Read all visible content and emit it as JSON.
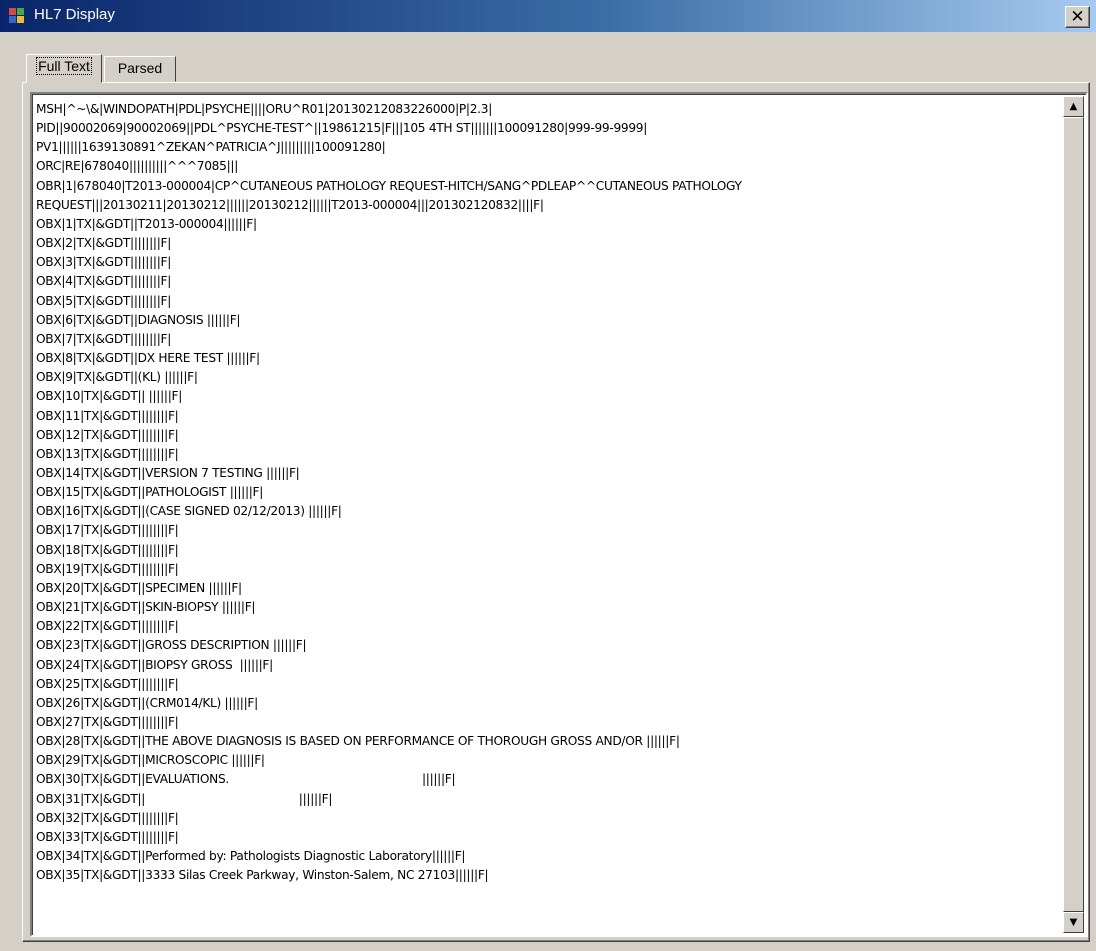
{
  "window": {
    "title": "HL7 Display",
    "close_label": "✕",
    "icon": "app-window-icon",
    "titlebar_colors": [
      "#0a246a",
      "#3a6ea5",
      "#a6caf0"
    ]
  },
  "tabs": [
    {
      "label": "Full Text",
      "active": true
    },
    {
      "label": "Parsed",
      "active": false
    }
  ],
  "scrollbar": {
    "up_icon": "▲",
    "down_icon": "▼"
  },
  "message_lines": [
    "MSH|^~\\&|WINDOPATH|PDL|PSYCHE||||ORU^R01|20130212083226000|P|2.3|",
    "PID||90002069|90002069||PDL^PSYCHE-TEST^||19861215|F|||105 4TH ST|||||||100091280|999-99-9999|",
    "PV1||||||1639130891^ZEKAN^PATRICIA^J|||||||||100091280|",
    "ORC|RE|678040||||||||||^^^7085|||",
    "OBR|1|678040|T2013-000004|CP^CUTANEOUS PATHOLOGY REQUEST-HITCH/SANG^PDLEAP^^CUTANEOUS PATHOLOGY",
    "REQUEST|||20130211|20130212||||||20130212||||||T2013-000004|||201302120832||||F|",
    "OBX|1|TX|&GDT||T2013-000004||||||F|",
    "OBX|2|TX|&GDT||||||||F|",
    "OBX|3|TX|&GDT||||||||F|",
    "OBX|4|TX|&GDT||||||||F|",
    "OBX|5|TX|&GDT||||||||F|",
    "OBX|6|TX|&GDT||DIAGNOSIS ||||||F|",
    "OBX|7|TX|&GDT||||||||F|",
    "OBX|8|TX|&GDT||DX HERE TEST ||||||F|",
    "OBX|9|TX|&GDT||(KL) ||||||F|",
    "OBX|10|TX|&GDT|| ||||||F|",
    "OBX|11|TX|&GDT||||||||F|",
    "OBX|12|TX|&GDT||||||||F|",
    "OBX|13|TX|&GDT||||||||F|",
    "OBX|14|TX|&GDT||VERSION 7 TESTING ||||||F|",
    "OBX|15|TX|&GDT||PATHOLOGIST ||||||F|",
    "OBX|16|TX|&GDT||(CASE SIGNED 02/12/2013) ||||||F|",
    "OBX|17|TX|&GDT||||||||F|",
    "OBX|18|TX|&GDT||||||||F|",
    "OBX|19|TX|&GDT||||||||F|",
    "OBX|20|TX|&GDT||SPECIMEN ||||||F|",
    "OBX|21|TX|&GDT||SKIN-BIOPSY ||||||F|",
    "OBX|22|TX|&GDT||||||||F|",
    "OBX|23|TX|&GDT||GROSS DESCRIPTION ||||||F|",
    "OBX|24|TX|&GDT||BIOPSY GROSS  ||||||F|",
    "OBX|25|TX|&GDT||||||||F|",
    "OBX|26|TX|&GDT||(CRM014/KL) ||||||F|",
    "OBX|27|TX|&GDT||||||||F|",
    "OBX|28|TX|&GDT||THE ABOVE DIAGNOSIS IS BASED ON PERFORMANCE OF THOROUGH GROSS AND/OR ||||||F|",
    "OBX|29|TX|&GDT||MICROSCOPIC ||||||F|",
    "OBX|30|TX|&GDT||EVALUATIONS.                                                      ||||||F|",
    "OBX|31|TX|&GDT||                                           ||||||F|",
    "OBX|32|TX|&GDT||||||||F|",
    "OBX|33|TX|&GDT||||||||F|",
    "OBX|34|TX|&GDT||Performed by: Pathologists Diagnostic Laboratory||||||F|",
    "OBX|35|TX|&GDT||3333 Silas Creek Parkway, Winston-Salem, NC 27103||||||F|"
  ]
}
